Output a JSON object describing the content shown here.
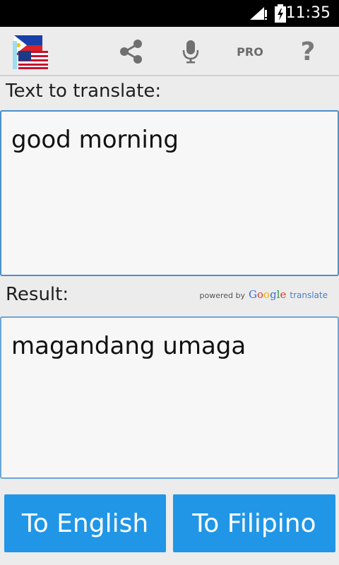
{
  "status_bar": {
    "time": "11:35",
    "icons": [
      "signal-icon",
      "battery-icon"
    ]
  },
  "toolbar": {
    "logo_icon": "philippines-usa-flags-icon",
    "share_icon": "share-icon",
    "mic_icon": "microphone-icon",
    "pro_label": "PRO",
    "help_label": "?"
  },
  "input": {
    "label": "Text to translate:",
    "value": "good morning"
  },
  "result": {
    "label": "Result:",
    "value": "magandang umaga",
    "powered_by": "powered by",
    "google_letters": [
      "G",
      "o",
      "o",
      "g",
      "l",
      "e"
    ],
    "translate": "translate"
  },
  "buttons": {
    "to_english": "To English",
    "to_filipino": "To Filipino"
  },
  "colors": {
    "accent": "#2196e6",
    "border": "#4a90c8",
    "background": "#ececec"
  }
}
